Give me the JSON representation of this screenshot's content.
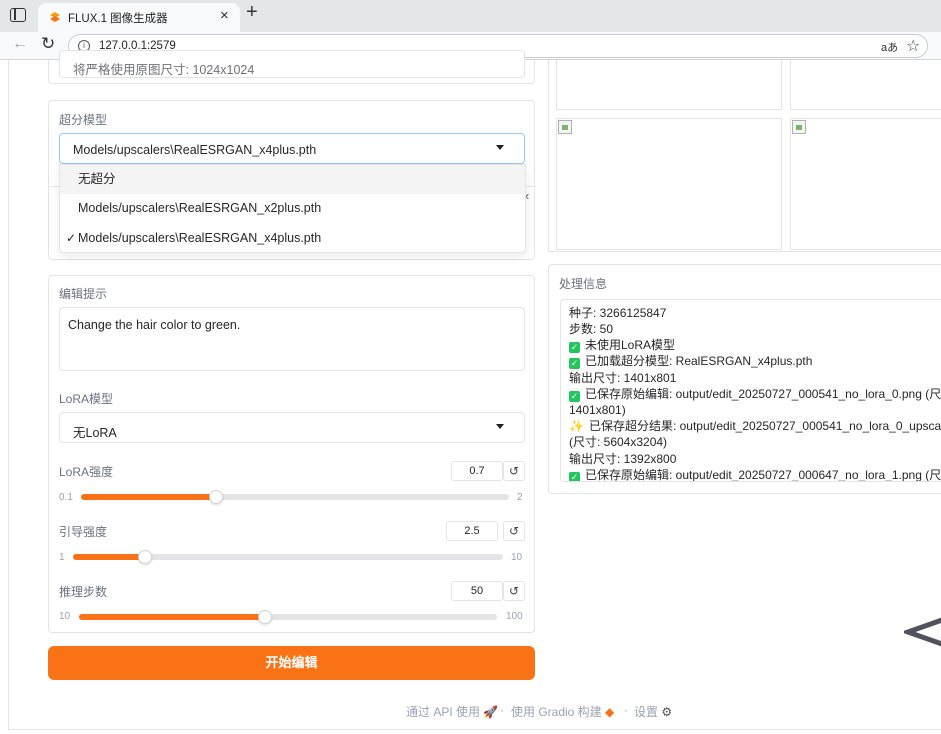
{
  "browser": {
    "tab_title": "FLUX.1 图像生成器",
    "url": "127.0.0.1:2579",
    "read_aloud_label": "aあ"
  },
  "left": {
    "size_hint": "将严格使用原图尺寸: 1024x1024",
    "upscale": {
      "label": "超分模型",
      "selected": "Models/upscalers\\RealESRGAN_x4plus.pth",
      "options": [
        {
          "label": "无超分",
          "checked": false
        },
        {
          "label": "Models/upscalers\\RealESRGAN_x2plus.pth",
          "checked": false
        },
        {
          "label": "Models/upscalers\\RealESRGAN_x4plus.pth",
          "checked": true
        }
      ],
      "check_mark": "✓"
    },
    "prompt": {
      "label": "编辑提示",
      "value": "Change the hair color to green."
    },
    "lora": {
      "label": "LoRA模型",
      "selected": "无LoRA"
    },
    "sliders": [
      {
        "label": "LoRA强度",
        "value": "0.7",
        "min": "0.1",
        "max": "2",
        "fraction": 0.316
      },
      {
        "label": "引导强度",
        "value": "2.5",
        "min": "1",
        "max": "10",
        "fraction": 0.167
      },
      {
        "label": "推理步数",
        "value": "50",
        "min": "10",
        "max": "100",
        "fraction": 0.444
      }
    ],
    "start_button": "开始编辑"
  },
  "right": {
    "info_label": "处理信息",
    "log": [
      "种子: 3266125847",
      "步数: 50",
      "未使用LoRA模型",
      "已加载超分模型: RealESRGAN_x4plus.pth",
      "输出尺寸: 1401x801",
      "已保存原始编辑: output/edit_20250727_000541_no_lora_0.png (尺",
      "1401x801)",
      "已保存超分结果: output/edit_20250727_000541_no_lora_0_upsca",
      "(尺寸: 5604x3204)",
      "输出尺寸: 1392x800",
      "已保存原始编辑: output/edit_20250727_000647_no_lora_1.png (尺"
    ]
  },
  "footer": {
    "api": "通过 API 使用",
    "gradio": "使用 Gradio 构建",
    "settings": "设置",
    "separator": "·"
  },
  "colors": {
    "accent": "#f97316",
    "success": "#22c55e"
  }
}
